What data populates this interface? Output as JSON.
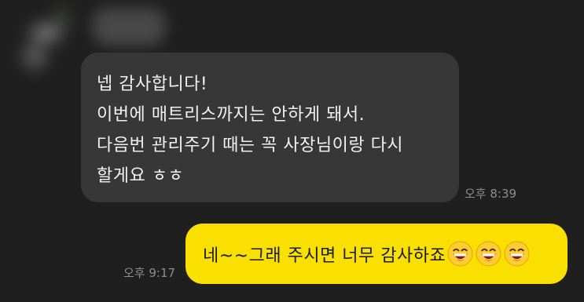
{
  "incoming": {
    "lines": [
      "넵 감사합니다!",
      "이번에 매트리스까지는 안하게 돼서.",
      "다음번 관리주기 때는 꼭 사장님이랑 다시",
      "할게요 ㅎㅎ"
    ],
    "time": "오후 8:39"
  },
  "outgoing": {
    "text": "네~~그래 주시면 너무 감사하죠",
    "emoji": [
      "laughing-face-icon",
      "laughing-face-icon",
      "laughing-face-icon"
    ],
    "time": "오후 9:17"
  },
  "colors": {
    "background": "#1f1f1f",
    "incoming_bubble": "#373737",
    "outgoing_bubble": "#f9e000",
    "timestamp": "#8e8e8e"
  }
}
